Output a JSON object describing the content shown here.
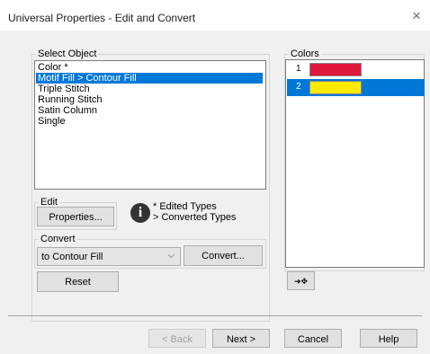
{
  "window": {
    "title": "Universal Properties - Edit and Convert",
    "close_icon": "×"
  },
  "select_object": {
    "label": "Select Object",
    "items": [
      {
        "label": "Color *",
        "selected": false
      },
      {
        "label": "Motif Fill > Contour Fill",
        "selected": true
      },
      {
        "label": "Triple Stitch",
        "selected": false
      },
      {
        "label": "Running Stitch",
        "selected": false
      },
      {
        "label": "Satin Column",
        "selected": false
      },
      {
        "label": "Single",
        "selected": false
      }
    ]
  },
  "edit": {
    "label": "Edit",
    "properties_button": "Properties..."
  },
  "legend": {
    "icon": "info-icon",
    "glyph": "i",
    "edited": "* Edited Types",
    "converted": "> Converted Types"
  },
  "convert": {
    "label": "Convert",
    "selected_value": "to Contour Fill",
    "dropdown_arrow": "⌵",
    "convert_button": "Convert..."
  },
  "reset_button": "Reset",
  "colors": {
    "label": "Colors",
    "items": [
      {
        "number": "1",
        "color": "#e0173d",
        "selected": false
      },
      {
        "number": "2",
        "color": "#ffea00",
        "selected": true
      }
    ],
    "add_button_glyph": "➜✥"
  },
  "footer": {
    "back": "< Back",
    "next": "Next >",
    "cancel": "Cancel",
    "help": "Help"
  }
}
